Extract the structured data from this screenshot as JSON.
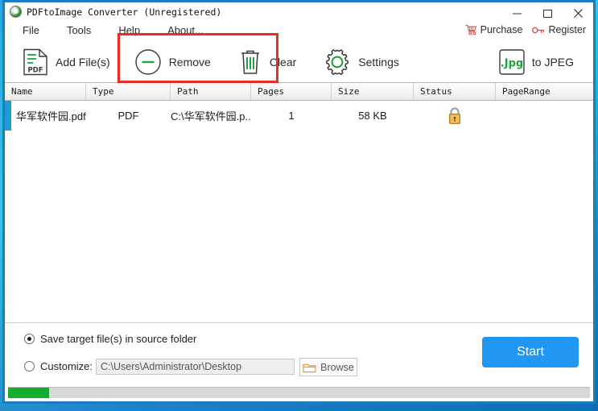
{
  "window": {
    "title": "PDFtoImage Converter  (Unregistered)",
    "app_icon": "app-logo-icon",
    "controls": {
      "minimize": "minimize-icon",
      "maximize": "maximize-icon",
      "close": "close-icon"
    }
  },
  "menubar": {
    "items": [
      {
        "label": "File"
      },
      {
        "label": "Tools"
      },
      {
        "label": "Help"
      },
      {
        "label": "About..."
      }
    ],
    "links": [
      {
        "label": "Purchase",
        "icon": "shopping-cart-icon",
        "color": "#e04040"
      },
      {
        "label": "Register",
        "icon": "key-icon",
        "color": "#e04040"
      }
    ]
  },
  "toolbar": {
    "add_files": {
      "label": "Add File(s)",
      "icon": "pdf-file-icon"
    },
    "remove": {
      "label": "Remove",
      "icon": "minus-circle-icon"
    },
    "clear": {
      "label": "Clear",
      "icon": "trash-can-icon"
    },
    "settings": {
      "label": "Settings",
      "icon": "gear-icon"
    },
    "format": {
      "label": "to JPEG",
      "icon": "jpg-badge-icon",
      "badge_text": ".Jpg"
    },
    "dropdown": {
      "icon": "chevron-down-icon"
    },
    "accent_color": "#22a245",
    "annotation_color": "#ee2a25"
  },
  "file_list": {
    "columns": [
      {
        "key": "name",
        "label": "Name",
        "width": 101
      },
      {
        "key": "type",
        "label": "Type",
        "width": 105
      },
      {
        "key": "path",
        "label": "Path",
        "width": 100
      },
      {
        "key": "pages",
        "label": "Pages",
        "width": 100
      },
      {
        "key": "size",
        "label": "Size",
        "width": 102
      },
      {
        "key": "status",
        "label": "Status",
        "width": 102
      },
      {
        "key": "pagerange",
        "label": "PageRange",
        "width": 101
      }
    ],
    "rows": [
      {
        "name": "华军软件园.pdf",
        "type": "PDF",
        "path": "C:\\华军软件园.p...",
        "pages": "1",
        "size": "58 KB",
        "status_icon": "lock-icon",
        "pagerange": "",
        "selected": true
      }
    ]
  },
  "output": {
    "option_source": {
      "label": "Save target file(s) in source folder",
      "selected": true
    },
    "option_custom": {
      "label": "Customize:",
      "selected": false
    },
    "custom_path_value": "C:\\Users\\Administrator\\Desktop",
    "browse": {
      "label": "Browse",
      "icon": "folder-icon"
    },
    "start": {
      "label": "Start",
      "color": "#2196f3"
    }
  },
  "progress": {
    "percent": 7,
    "fill_color": "#14ae2e"
  }
}
